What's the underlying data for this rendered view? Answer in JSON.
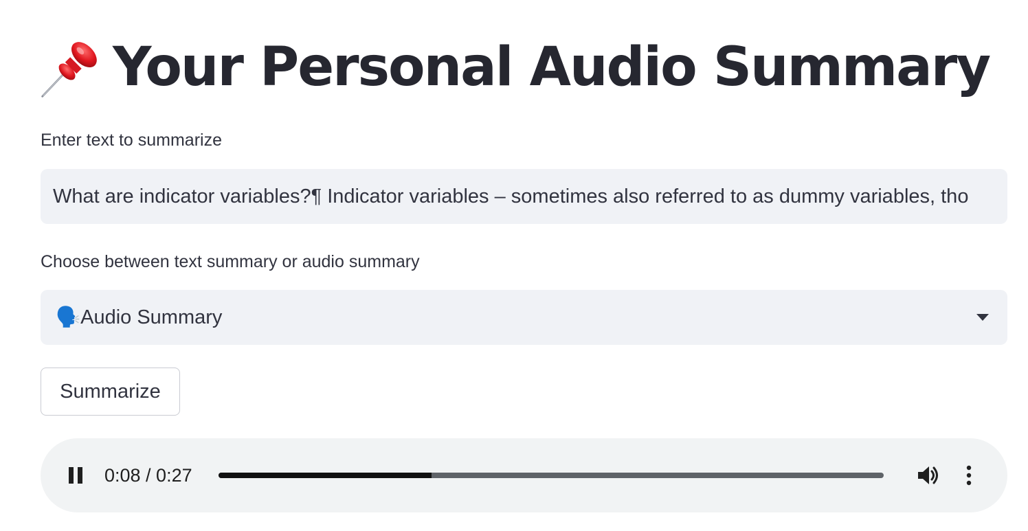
{
  "header": {
    "title": "Your Personal Audio Summary",
    "title_icon": "pushpin-icon"
  },
  "text_input": {
    "label": "Enter text to summarize",
    "value": "What are indicator variables?¶ Indicator variables – sometimes also referred to as dummy variables, tho"
  },
  "summary_type": {
    "label": "Choose between text summary or audio summary",
    "selected": "🗣️Audio Summary",
    "icon": "chevron-down-icon"
  },
  "actions": {
    "summarize_label": "Summarize"
  },
  "audio_player": {
    "time": "0:08 / 0:27",
    "progress": 0.32,
    "state": "playing",
    "icons": [
      "pause-icon",
      "volume-icon",
      "more-options-icon"
    ]
  },
  "colors": {
    "title": "#262730",
    "text": "#31333f",
    "input_bg": "#f0f2f6",
    "player_bg": "#f1f3f4",
    "progress_played": "#111111",
    "progress_remaining": "#5f6368"
  }
}
